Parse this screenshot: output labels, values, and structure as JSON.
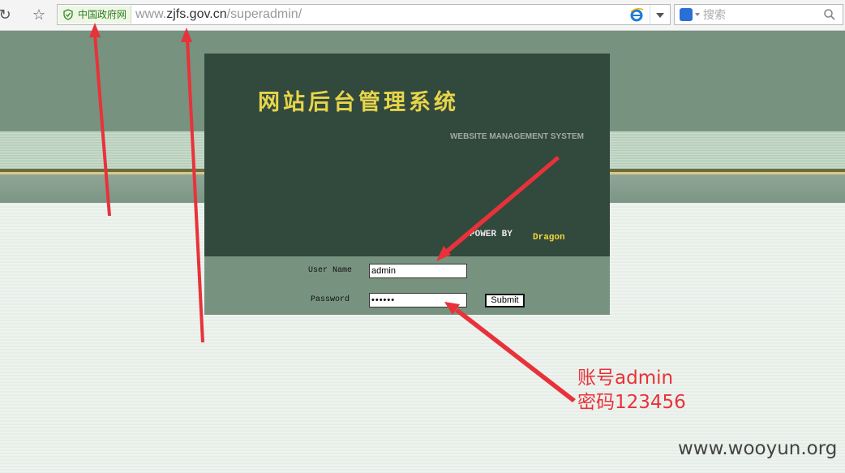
{
  "browser": {
    "gov_badge": "中国政府网",
    "url_prefix": "www.",
    "url_host": "zjfs.gov.cn",
    "url_path": "/superadmin/",
    "search_placeholder": "搜索"
  },
  "login": {
    "title_cn": "网站后台管理系统",
    "title_en": "WEBSITE MANAGEMENT SYSTEM",
    "power_by": "POWER BY",
    "dragon": "Dragon",
    "username_label": "User Name",
    "password_label": "Password",
    "username_value": "admin",
    "password_value": "••••••",
    "submit_label": "Submit"
  },
  "annotations": {
    "account_note": "账号admin",
    "password_note": "密码123456",
    "arrow_color": "#e8323a"
  },
  "watermark": "www.wooyun.org",
  "colors": {
    "panel_dark": "#32493d",
    "panel_form": "#77937f",
    "title_yellow": "#e7d54a"
  }
}
